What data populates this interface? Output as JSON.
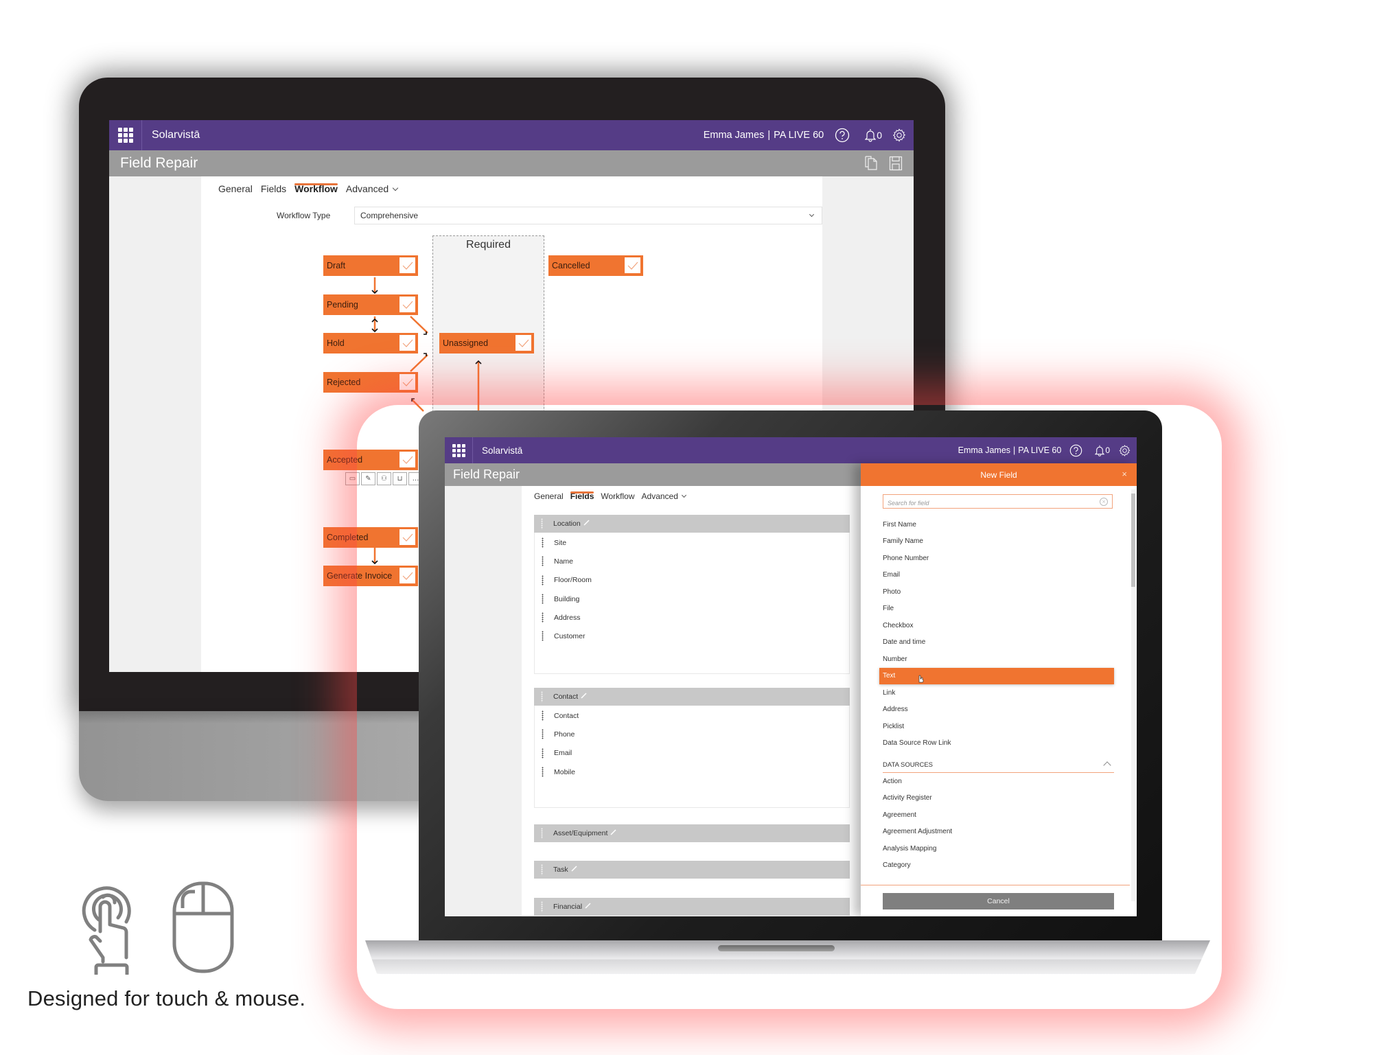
{
  "colors": {
    "brand_purple": "#553c86",
    "accent_orange": "#f07430",
    "title_gray": "#9b9b9b",
    "section_gray": "#c8c8c8",
    "cancel_gray": "#7f7f7f"
  },
  "monitor": {
    "header": {
      "brand": "Solarvistā",
      "user": "Emma James",
      "separator": "|",
      "environment": "PA LIVE 60",
      "notification_count": "0",
      "icons": [
        "apps-grid-icon",
        "help-icon",
        "bell-icon",
        "gear-icon"
      ]
    },
    "title": "Field Repair",
    "title_actions": [
      "copy-icon",
      "save-icon"
    ],
    "tabs": [
      {
        "label": "General",
        "active": false
      },
      {
        "label": "Fields",
        "active": false
      },
      {
        "label": "Workflow",
        "active": true
      },
      {
        "label": "Advanced",
        "active": false,
        "dropdown": true
      }
    ],
    "workflow": {
      "type_label": "Workflow Type",
      "type_value": "Comprehensive",
      "required_zone_label": "Required",
      "nodes": [
        {
          "label": "Draft",
          "checked": true
        },
        {
          "label": "Pending",
          "checked": true
        },
        {
          "label": "Hold",
          "checked": true
        },
        {
          "label": "Rejected",
          "checked": true
        },
        {
          "label": "Unassigned",
          "checked": true
        },
        {
          "label": "Cancelled",
          "checked": true
        },
        {
          "label": "Accepted",
          "checked": true
        },
        {
          "label": "Completed",
          "checked": true
        },
        {
          "label": "Generate Invoice",
          "checked": true
        }
      ],
      "accepted_tools": [
        "money-icon",
        "signature-icon",
        "parts-icon",
        "trolley-icon",
        "more-icon"
      ],
      "more_label": "..."
    }
  },
  "laptop": {
    "header": {
      "brand": "Solarvistā",
      "user": "Emma James",
      "separator": "|",
      "environment": "PA LIVE 60",
      "notification_count": "0"
    },
    "title": "Field Repair",
    "tabs": [
      {
        "label": "General",
        "active": false
      },
      {
        "label": "Fields",
        "active": true
      },
      {
        "label": "Workflow",
        "active": false
      },
      {
        "label": "Advanced",
        "active": false,
        "dropdown": true
      }
    ],
    "field_groups": [
      {
        "name": "Location",
        "fields": [
          "Site",
          "Name",
          "Floor/Room",
          "Building",
          "Address",
          "Customer"
        ]
      },
      {
        "name": "Contact",
        "fields": [
          "Contact",
          "Phone",
          "Email",
          "Mobile"
        ]
      },
      {
        "name": "Asset/Equipment",
        "fields": []
      },
      {
        "name": "Task",
        "fields": []
      },
      {
        "name": "Financial",
        "fields": []
      }
    ],
    "new_field_panel": {
      "title": "New Field",
      "close_label": "×",
      "search_placeholder": "Search for field",
      "search_value": "",
      "field_types": [
        "First Name",
        "Family Name",
        "Phone Number",
        "Email",
        "Photo",
        "File",
        "Checkbox",
        "Date and time",
        "Number",
        "Text",
        "Link",
        "Address",
        "Picklist",
        "Data Source Row Link"
      ],
      "selected_field_type": "Text",
      "data_sources_header": "DATA SOURCES",
      "data_sources": [
        "Action",
        "Activity Register",
        "Agreement",
        "Agreement Adjustment",
        "Analysis Mapping",
        "Category"
      ],
      "cancel_label": "Cancel"
    }
  },
  "promo": {
    "caption": "Designed for touch & mouse.",
    "icons": [
      "touch-icon",
      "mouse-icon"
    ]
  }
}
